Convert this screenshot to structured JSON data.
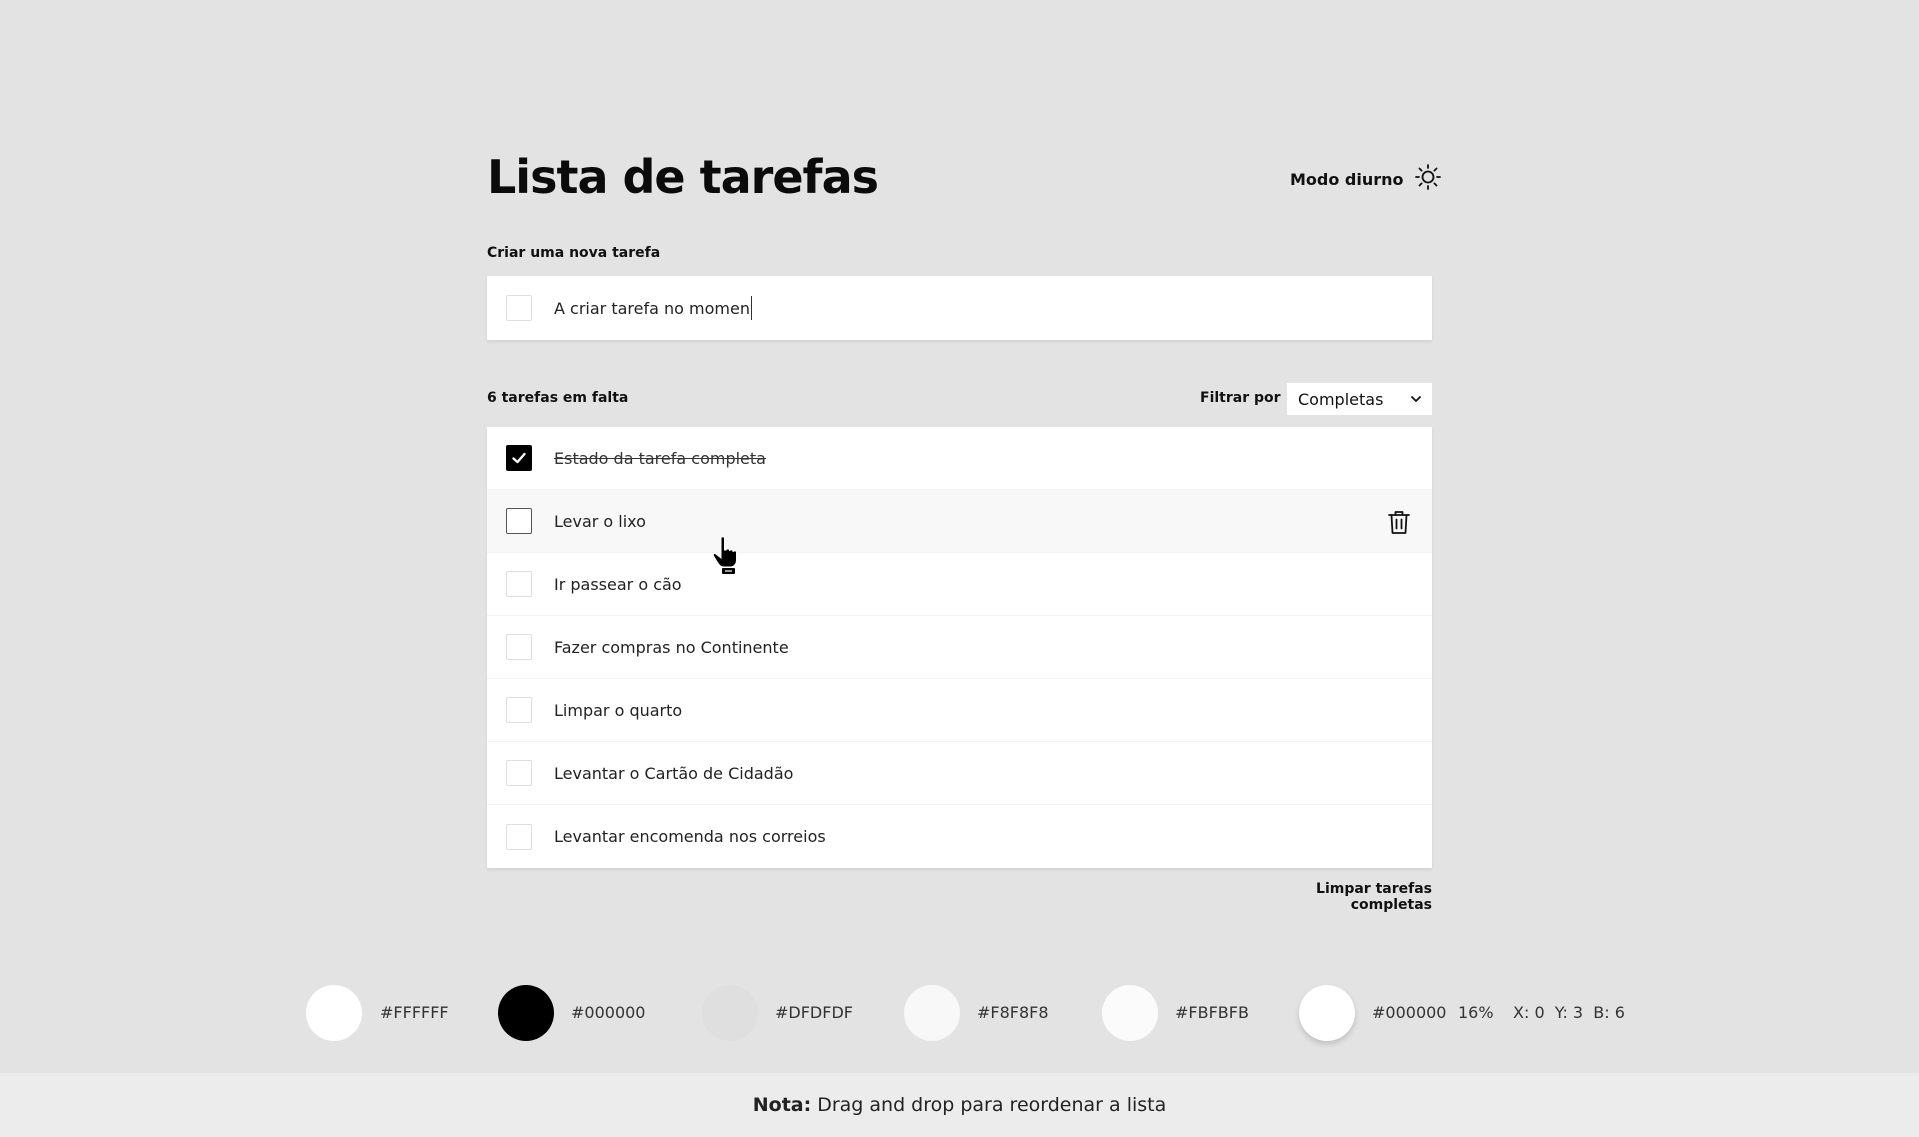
{
  "header": {
    "title": "Lista de tarefas",
    "mode_label": "Modo diurno",
    "mode_icon": "sun-icon"
  },
  "new_task": {
    "label": "Criar uma nova tarefa",
    "value": "A criar tarefa no momen"
  },
  "toolbar": {
    "remaining": "6 tarefas em falta",
    "filter_label": "Filtrar por",
    "filter_value": "Completas"
  },
  "tasks": [
    {
      "text": "Estado da tarefa completa",
      "completed": true
    },
    {
      "text": "Levar o lixo",
      "completed": false
    },
    {
      "text": "Ir passear o cão",
      "completed": false
    },
    {
      "text": "Fazer compras no Continente",
      "completed": false
    },
    {
      "text": "Limpar o quarto",
      "completed": false
    },
    {
      "text": "Levantar o Cartão de Cidadão",
      "completed": false
    },
    {
      "text": "Levantar encomenda nos correios",
      "completed": false
    }
  ],
  "clear_completed": "Limpar tarefas completas",
  "palette": [
    {
      "color": "#FFFFFF",
      "label": "#FFFFFF"
    },
    {
      "color": "#000000",
      "label": "#000000"
    },
    {
      "color": "#DFDFDF",
      "label": "#DFDFDF"
    },
    {
      "color": "#F8F8F8",
      "label": "#F8F8F8"
    },
    {
      "color": "#FBFBFB",
      "label": "#FBFBFB"
    },
    {
      "color": "#FFFFFF",
      "label": "#000000",
      "opacity": "16%",
      "shadow": "X: 0  Y: 3  B: 6"
    }
  ],
  "footer": {
    "note_label": "Nota:",
    "note_text": "Drag and drop para reordenar a lista"
  }
}
